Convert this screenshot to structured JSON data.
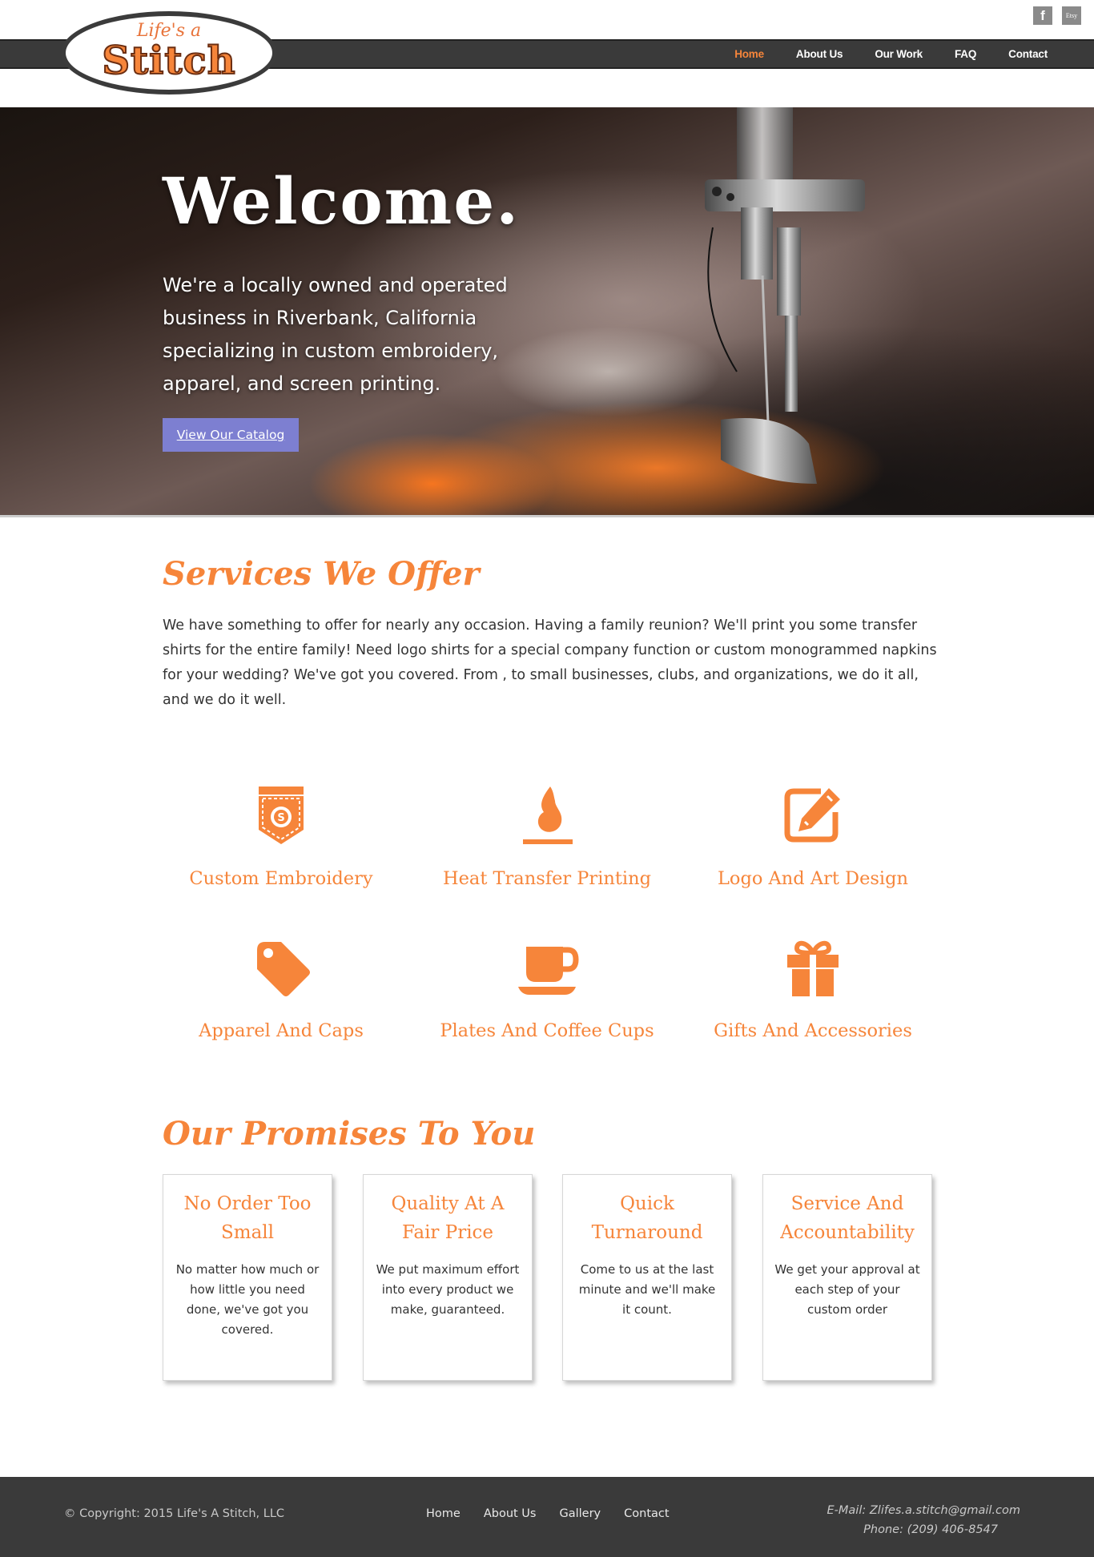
{
  "header": {
    "logo_line1": "Life's a",
    "logo_line2": "Stitch",
    "social": {
      "facebook_label": "f",
      "etsy_label": "Etsy"
    },
    "nav": [
      {
        "label": "Home",
        "active": true
      },
      {
        "label": "About Us"
      },
      {
        "label": "Our Work"
      },
      {
        "label": "FAQ"
      },
      {
        "label": "Contact"
      }
    ]
  },
  "hero": {
    "title": "Welcome.",
    "subtitle": "We're a locally owned and operated business in Riverbank, California specializing in custom embroidery, apparel, and screen printing.",
    "button_label": "View Our Catalog"
  },
  "services": {
    "title": "Services We Offer",
    "body": "We have something to offer for nearly any occasion. Having a family reunion? We'll print you some transfer shirts for the entire family! Need logo shirts for a special company function or custom monogrammed napkins for your wedding? We've got you covered. From , to small businesses, clubs, and organizations, we do it all, and we do it well.",
    "items": [
      {
        "label": "Custom Embroidery",
        "icon": "pocket-badge-icon"
      },
      {
        "label": "Heat Transfer Printing",
        "icon": "flame-icon"
      },
      {
        "label": "Logo And Art Design",
        "icon": "edit-pencil-icon"
      },
      {
        "label": "Apparel And Caps",
        "icon": "tag-icon"
      },
      {
        "label": "Plates And Coffee Cups",
        "icon": "coffee-cup-icon"
      },
      {
        "label": "Gifts And Accessories",
        "icon": "gift-icon"
      }
    ]
  },
  "promises": {
    "title": "Our Promises To You",
    "cards": [
      {
        "title": "No Order Too Small",
        "body": "No matter how much or how little you need done, we've got you covered."
      },
      {
        "title": "Quality At A Fair Price",
        "body": "We put maximum effort into every product we make, guaranteed."
      },
      {
        "title": "Quick Turnaround",
        "body": "Come to us at the last minute and we'll make it count."
      },
      {
        "title": "Service And Accountability",
        "body": "We get your approval at each step of your custom order"
      }
    ]
  },
  "footer": {
    "copyright": "© Copyright: 2015 Life's A Stitch, LLC",
    "links": [
      "Home",
      "About Us",
      "Gallery",
      "Contact"
    ],
    "email": "E-Mail: Zlifes.a.stitch@gmail.com",
    "phone": "Phone: (209) 406-8547"
  },
  "colors": {
    "accent": "#f6853a",
    "navbar": "#3a3a3a",
    "button": "#7d7fd1",
    "footer": "#3a3a3a"
  }
}
